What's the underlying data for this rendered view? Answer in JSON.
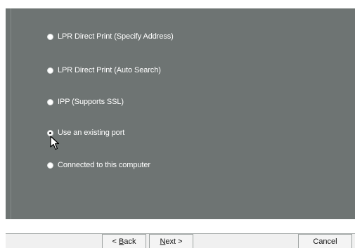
{
  "options": [
    {
      "label": "LPR Direct Print (Specify Address)",
      "checked": false
    },
    {
      "label": "LPR Direct Print (Auto Search)",
      "checked": false
    },
    {
      "label": "IPP (Supports SSL)",
      "checked": false
    },
    {
      "label": "Use an existing port",
      "checked": true
    },
    {
      "label": "Connected to this computer",
      "checked": false
    }
  ],
  "buttons": {
    "back_prefix": "< ",
    "back_accel": "B",
    "back_rest": "ack",
    "next_accel": "N",
    "next_rest": "ext >",
    "cancel_label": "Cancel"
  },
  "colors": {
    "panel": "#6e7473",
    "label": "#ffffff",
    "button_face": "#f4f4f4"
  },
  "icons": {
    "cursor": "arrow-cursor-icon",
    "radio": "radio-button-icon"
  }
}
